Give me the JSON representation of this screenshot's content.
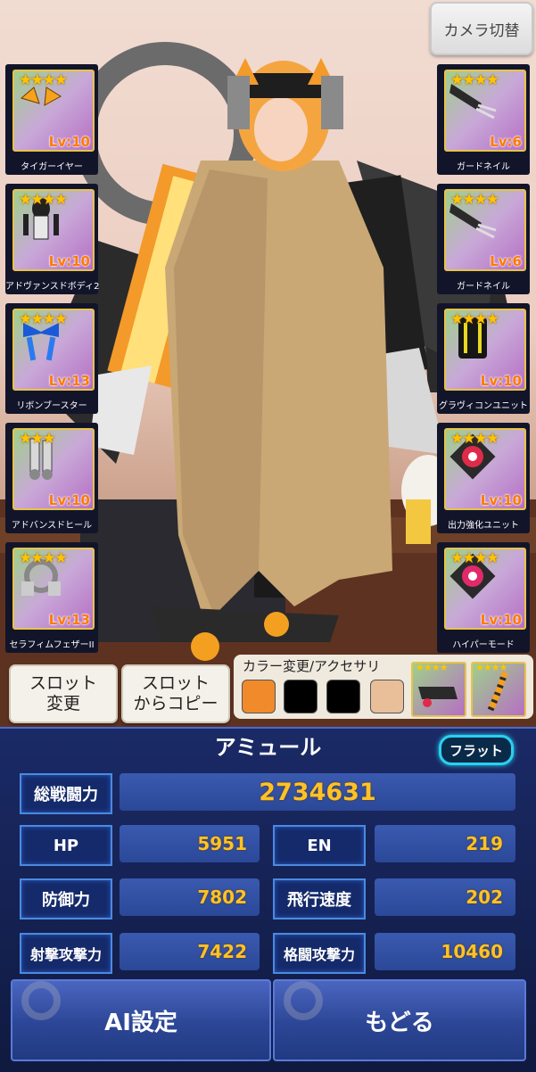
{
  "camera_button": "カメラ切替",
  "left_slots": [
    {
      "name": "タイガーイヤー",
      "level": "Lv:10",
      "stars": "★★★★",
      "icon": "tiger-ear-icon"
    },
    {
      "name": "アドヴァンスドボディ2",
      "level": "Lv:10",
      "stars": "★★★★",
      "icon": "body-armor-icon"
    },
    {
      "name": "リボンブースター",
      "level": "Lv:13",
      "stars": "★★★★",
      "icon": "ribbon-booster-icon"
    },
    {
      "name": "アドバンスドヒール",
      "level": "Lv:10",
      "stars": "★★★",
      "icon": "heel-icon"
    },
    {
      "name": "セラフィムフェザーII",
      "level": "Lv:13",
      "stars": "★★★★",
      "icon": "feather-icon"
    }
  ],
  "right_slots": [
    {
      "name": "ガードネイル",
      "level": "Lv:6",
      "stars": "★★★★",
      "icon": "claw-icon"
    },
    {
      "name": "ガードネイル",
      "level": "Lv:6",
      "stars": "★★★★",
      "icon": "claw-icon"
    },
    {
      "name": "グラヴィコンユニット",
      "level": "Lv:10",
      "stars": "★★★★",
      "icon": "gravicon-unit-icon"
    },
    {
      "name": "出力強化ユニット",
      "level": "Lv:10",
      "stars": "★★★★",
      "icon": "output-unit-icon"
    },
    {
      "name": "ハイパーモード",
      "level": "Lv:10",
      "stars": "★★★★",
      "icon": "hyper-mode-icon"
    }
  ],
  "slot_change_button": "スロット\n変更",
  "slot_copy_button": "スロット\nからコピー",
  "color_panel": {
    "title": "カラー変更/アクセサリ",
    "swatches": [
      "#f08a2a",
      "#000000",
      "#000000",
      "#e9bf9a"
    ],
    "accessories": [
      {
        "stars": "★★★★",
        "icon": "gun-accessory-icon"
      },
      {
        "stars": "★★★★",
        "icon": "tail-accessory-icon"
      }
    ]
  },
  "character": {
    "name": "アミュール",
    "badge": "フラット"
  },
  "stats": {
    "total_label": "総戦闘力",
    "total_value": "2734631",
    "hp_label": "HP",
    "hp_value": "5951",
    "en_label": "EN",
    "en_value": "219",
    "defense_label": "防御力",
    "defense_value": "7802",
    "flight_label": "飛行速度",
    "flight_value": "202",
    "shoot_label": "射撃攻撃力",
    "shoot_value": "7422",
    "melee_label": "格闘攻撃力",
    "melee_value": "10460"
  },
  "buttons": {
    "ai": "AI設定",
    "back": "もどる"
  }
}
